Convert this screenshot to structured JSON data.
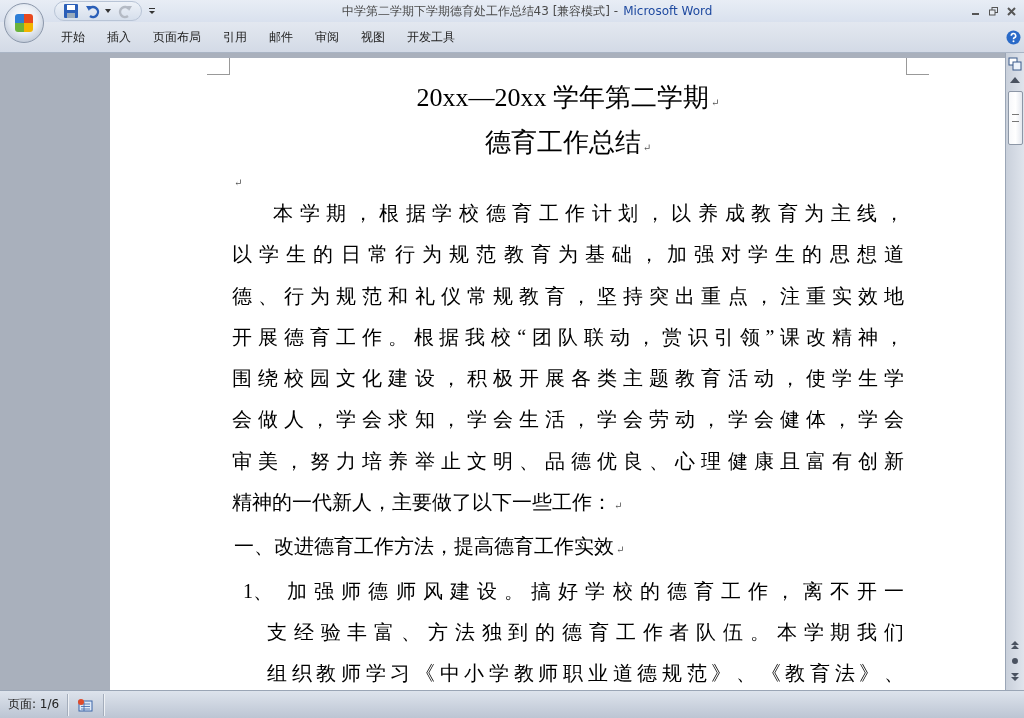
{
  "window": {
    "title": "中学第二学期下学期德育处工作总结43 [兼容模式] -",
    "app": "Microsoft Word"
  },
  "quick_access": [
    {
      "kind": "save",
      "disabled": false
    },
    {
      "kind": "undo",
      "disabled": false
    },
    {
      "kind": "redo",
      "disabled": true
    }
  ],
  "ribbon_tabs": [
    "开始",
    "插入",
    "页面布局",
    "引用",
    "邮件",
    "审阅",
    "视图",
    "开发工具"
  ],
  "document": [
    {
      "kind": "title",
      "lines": [
        "20xx—20xx 学年第二学期"
      ],
      "end_mark": "↵"
    },
    {
      "kind": "title",
      "lines": [
        "德育工作总结"
      ],
      "end_mark": "↵"
    },
    {
      "kind": "empty",
      "end_mark": "↵"
    },
    {
      "kind": "body",
      "lines": [
        "本学期，根据学校德育工作计划，以养成教育为主线，",
        "以学生的日常行为规范教育为基础，加强对学生的思想道",
        "德、行为规范和礼仪常规教育，坚持突出重点，注重实效地",
        "开展德育工作。根据我校“团队联动，赏识引领”课改精神，",
        "围绕校园文化建设，积极开展各类主题教育活动，使学生学",
        "会做人，学会求知，学会生活，学会劳动，学会健体，学会",
        "审美，努力培养举止文明、品德优良、心理健康且富有创新",
        "精神的一代新人，主要做了以下一些工作："
      ],
      "end_mark": "↵"
    },
    {
      "kind": "heading",
      "lines": [
        "一、改进德育工作方法，提高德育工作实效"
      ],
      "end_mark": "↵"
    },
    {
      "kind": "list_item",
      "number": "1、",
      "lines": [
        "加强师德师风建设。搞好学校的德育工作，离不开一",
        "支经验丰富、方法独到的德育工作者队伍。本学期我们",
        "组织教师学习《中小学教师职业道德规范》、《教育法》、"
      ]
    }
  ],
  "status_bar": {
    "page": "页面: 1/6"
  }
}
